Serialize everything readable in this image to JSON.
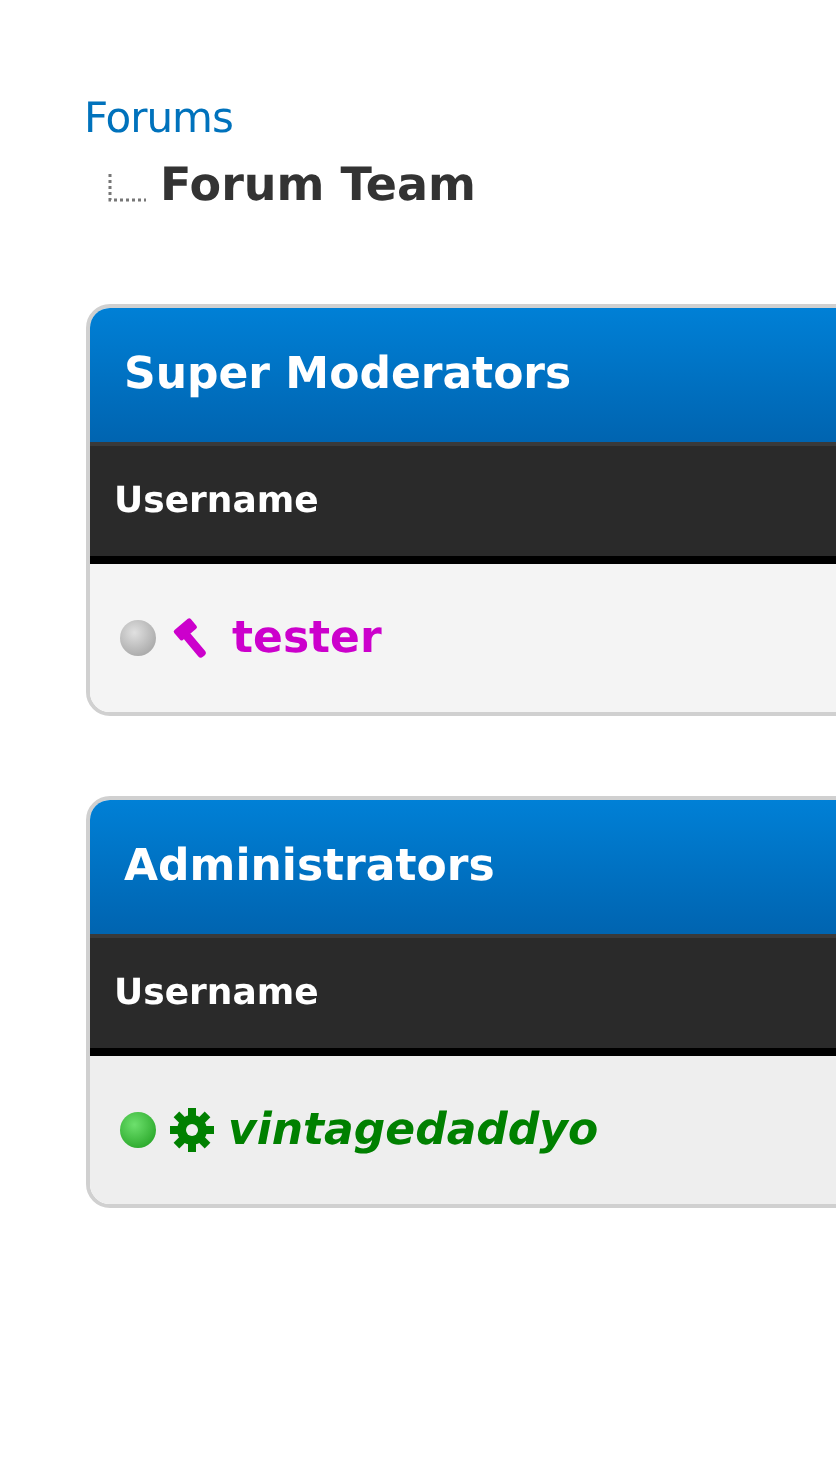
{
  "breadcrumb": {
    "link": "Forums",
    "current": "Forum Team"
  },
  "groups": [
    {
      "title": "Super Moderators",
      "column": "Username",
      "members": [
        {
          "name": "tester",
          "online": false,
          "kind": "moderator",
          "color": "#cc00cc"
        }
      ]
    },
    {
      "title": "Administrators",
      "column": "Username",
      "members": [
        {
          "name": "vintagedaddyo",
          "online": true,
          "kind": "admin",
          "color": "#008000"
        }
      ]
    }
  ]
}
